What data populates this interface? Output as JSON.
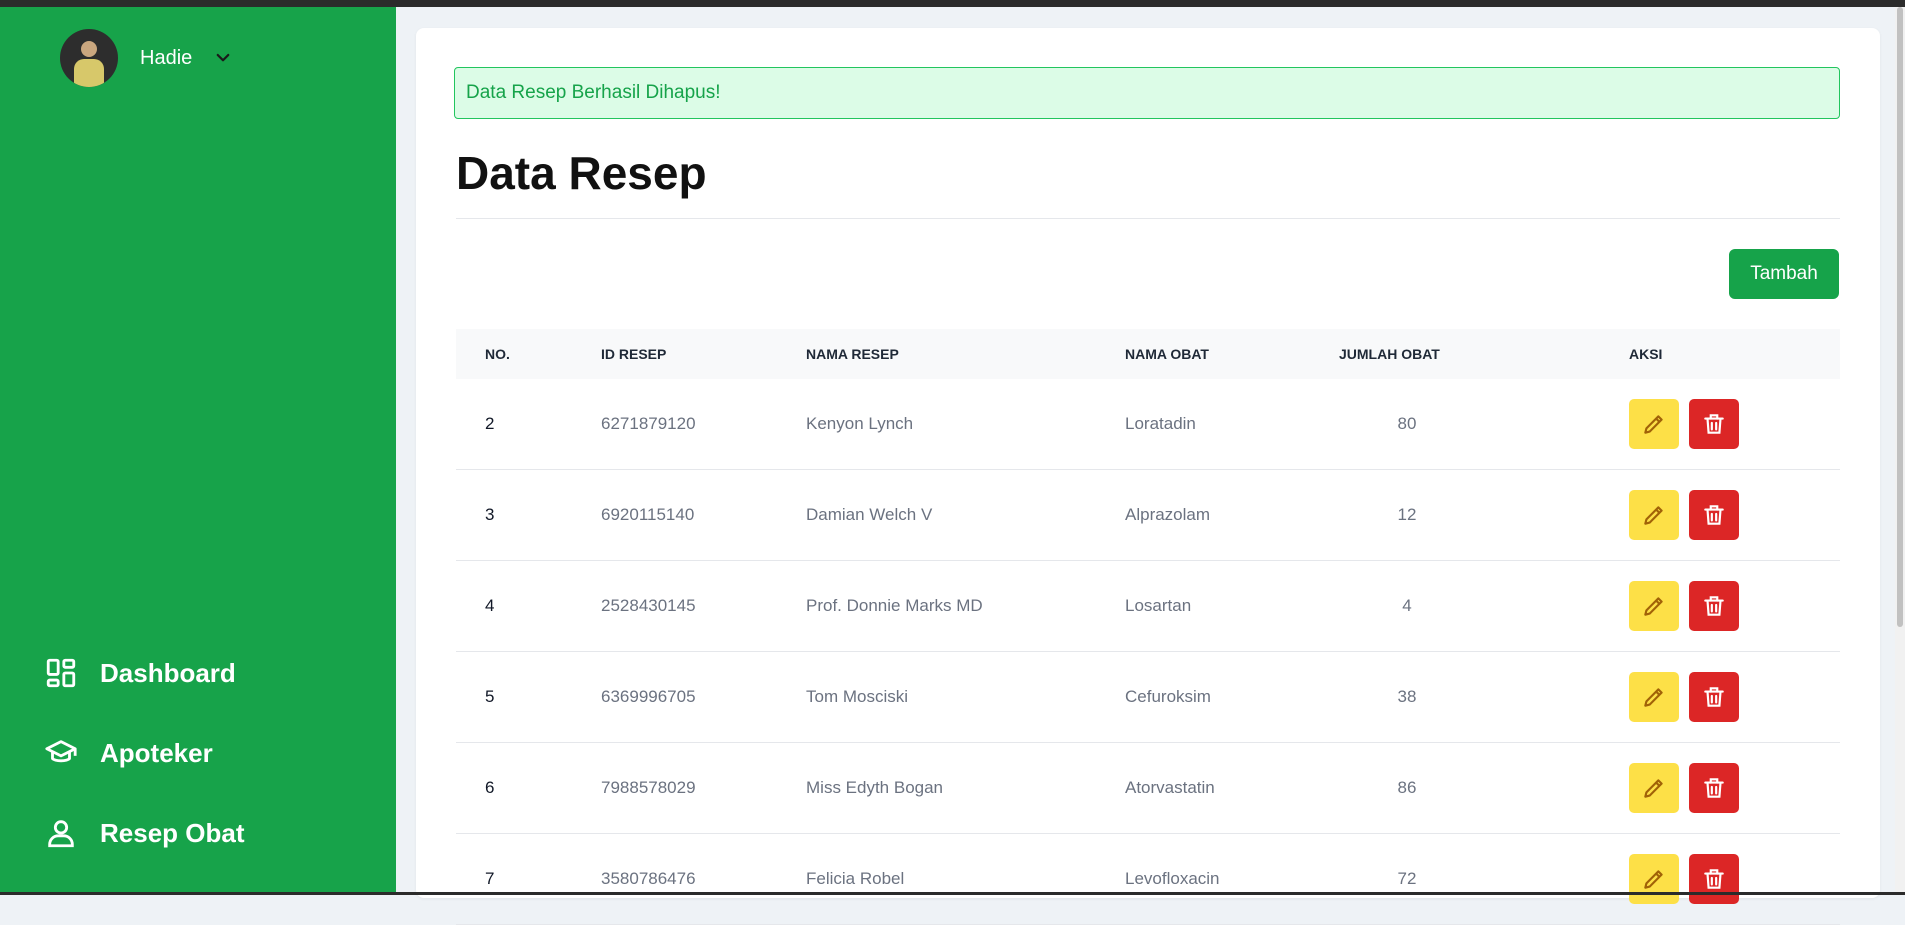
{
  "user": {
    "name": "Hadie"
  },
  "nav": [
    {
      "label": "Dashboard",
      "icon": "dashboard-icon"
    },
    {
      "label": "Apoteker",
      "icon": "graduation-cap-icon"
    },
    {
      "label": "Resep Obat",
      "icon": "user-icon"
    }
  ],
  "alert": {
    "message": "Data Resep Berhasil Dihapus!"
  },
  "page": {
    "title": "Data Resep",
    "add_label": "Tambah"
  },
  "table": {
    "headers": [
      "NO.",
      "ID RESEP",
      "NAMA RESEP",
      "NAMA OBAT",
      "JUMLAH OBAT",
      "AKSI"
    ],
    "rows": [
      {
        "no": "2",
        "id": "6271879120",
        "nama_resep": "Kenyon Lynch",
        "nama_obat": "Loratadin",
        "jumlah": "80"
      },
      {
        "no": "3",
        "id": "6920115140",
        "nama_resep": "Damian Welch V",
        "nama_obat": "Alprazolam",
        "jumlah": "12"
      },
      {
        "no": "4",
        "id": "2528430145",
        "nama_resep": "Prof. Donnie Marks MD",
        "nama_obat": "Losartan",
        "jumlah": "4"
      },
      {
        "no": "5",
        "id": "6369996705",
        "nama_resep": "Tom Mosciski",
        "nama_obat": "Cefuroksim",
        "jumlah": "38"
      },
      {
        "no": "6",
        "id": "7988578029",
        "nama_resep": "Miss Edyth Bogan",
        "nama_obat": "Atorvastatin",
        "jumlah": "86"
      },
      {
        "no": "7",
        "id": "3580786476",
        "nama_resep": "Felicia Robel",
        "nama_obat": "Levofloxacin",
        "jumlah": "72"
      }
    ]
  },
  "colors": {
    "sidebar": "#17a34a",
    "primary": "#16a34a",
    "edit": "#fde047",
    "delete": "#dc2626",
    "alert_bg": "#dcfce7"
  }
}
